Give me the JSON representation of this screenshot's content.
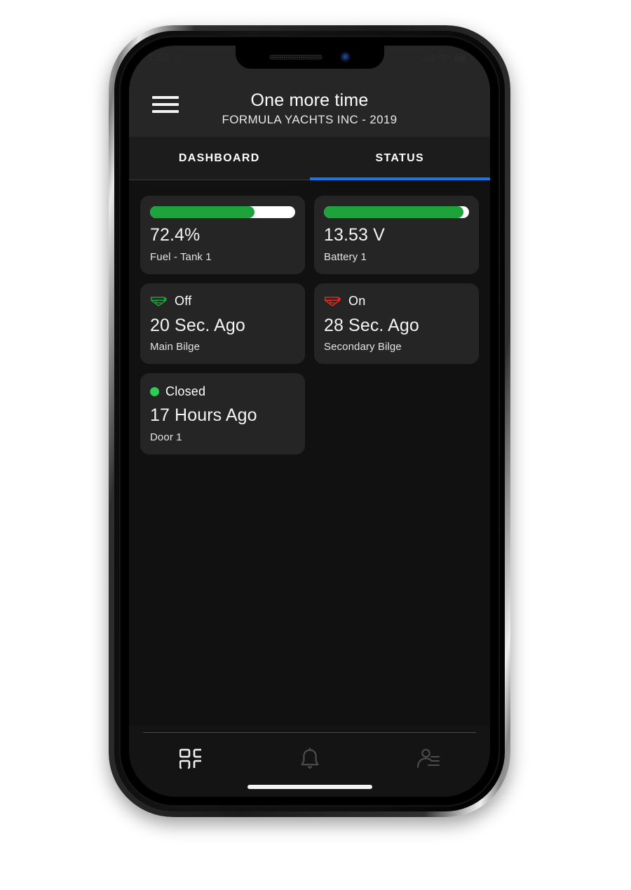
{
  "status_bar": {
    "time": "1:53",
    "location_icon": "location-arrow-icon",
    "signal_icon": "cellular-signal-icon",
    "wifi_icon": "wifi-icon",
    "battery_icon": "battery-icon",
    "icon_color": "#2a2a2a"
  },
  "header": {
    "menu_icon": "hamburger-menu-icon",
    "title": "One more time",
    "subtitle": "FORMULA YACHTS INC - 2019",
    "background": "#262626"
  },
  "tabs": {
    "active_color": "#1479f0",
    "items": [
      {
        "label": "DASHBOARD",
        "active": false
      },
      {
        "label": "STATUS",
        "active": true
      }
    ]
  },
  "cards": [
    {
      "type": "gauge",
      "value": "72.4%",
      "label": "Fuel - Tank 1",
      "fill_percent": 72,
      "fill_color": "#1ea33c",
      "track_color": "#ffffff"
    },
    {
      "type": "gauge",
      "value": "13.53 V",
      "label": "Battery 1",
      "fill_percent": 96,
      "fill_color": "#1ea33c",
      "track_color": "#ffffff"
    },
    {
      "type": "state",
      "icon": "bilge-pump-icon",
      "icon_color": "#1ea33c",
      "state": "Off",
      "value": "20 Sec. Ago",
      "label": "Main Bilge"
    },
    {
      "type": "state",
      "icon": "bilge-pump-icon",
      "icon_color": "#e02b1d",
      "state": "On",
      "value": "28 Sec. Ago",
      "label": "Secondary Bilge"
    },
    {
      "type": "state",
      "icon": "status-dot-icon",
      "icon_color": "#2ecc55",
      "state": "Closed",
      "value": "17 Hours Ago",
      "label": "Door 1"
    }
  ],
  "bottom_nav": {
    "items": [
      {
        "icon": "dashboard-grid-icon",
        "active": true
      },
      {
        "icon": "bell-icon",
        "active": false
      },
      {
        "icon": "crew-contact-icon",
        "active": false
      }
    ],
    "active_color": "#f2f2f2",
    "inactive_color": "#4d4d4d",
    "home_indicator": "home-indicator"
  }
}
